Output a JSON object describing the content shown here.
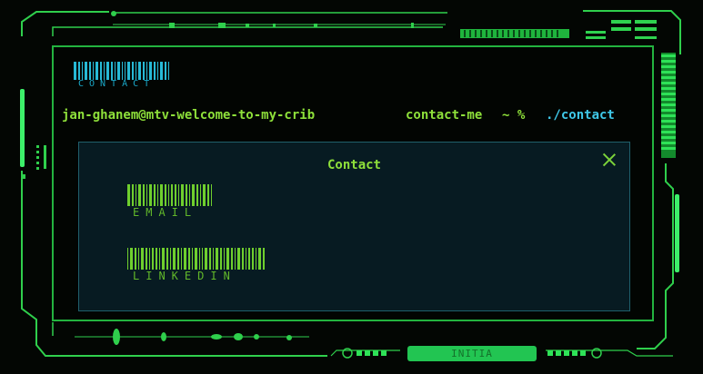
{
  "header": {
    "brand_caption": "CONTACT"
  },
  "terminal": {
    "user_host": "jan-ghanem@mtv-welcome-to-my-crib",
    "directory": "contact-me",
    "prompt_symbol": "~ %",
    "command": "./contact"
  },
  "modal": {
    "title": "Contact",
    "links": [
      {
        "label": "EMAIL"
      },
      {
        "label": "LINKEDIN"
      }
    ]
  },
  "footer": {
    "status_label": "INITIA"
  },
  "colors": {
    "frame": "#23b33f",
    "accent_green": "#8ee03a",
    "accent_cyan": "#3fc8e8",
    "modal_bg": "#071b22"
  }
}
